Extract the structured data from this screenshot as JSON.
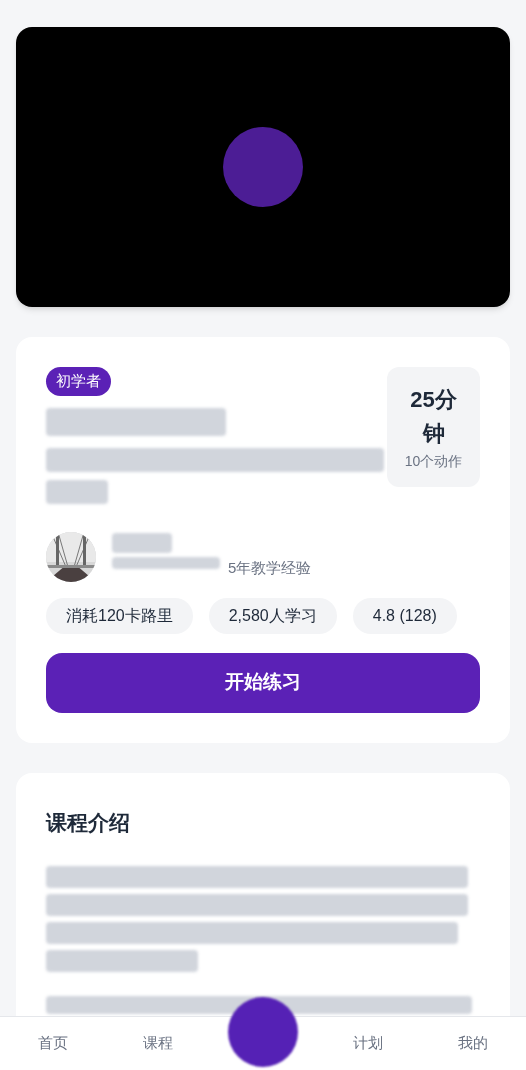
{
  "course": {
    "level_badge": "初学者",
    "duration": "25分钟",
    "actions": "10个动作",
    "instructor_experience": "5年教学经验",
    "stats": [
      "消耗120卡路里",
      "2,580人学习",
      "4.8 (128)"
    ],
    "start_button": "开始练习"
  },
  "intro": {
    "title": "课程介绍"
  },
  "nav": [
    {
      "label": "首页"
    },
    {
      "label": "课程"
    },
    {
      "kind": "center"
    },
    {
      "label": "计划"
    },
    {
      "label": "我的"
    }
  ]
}
